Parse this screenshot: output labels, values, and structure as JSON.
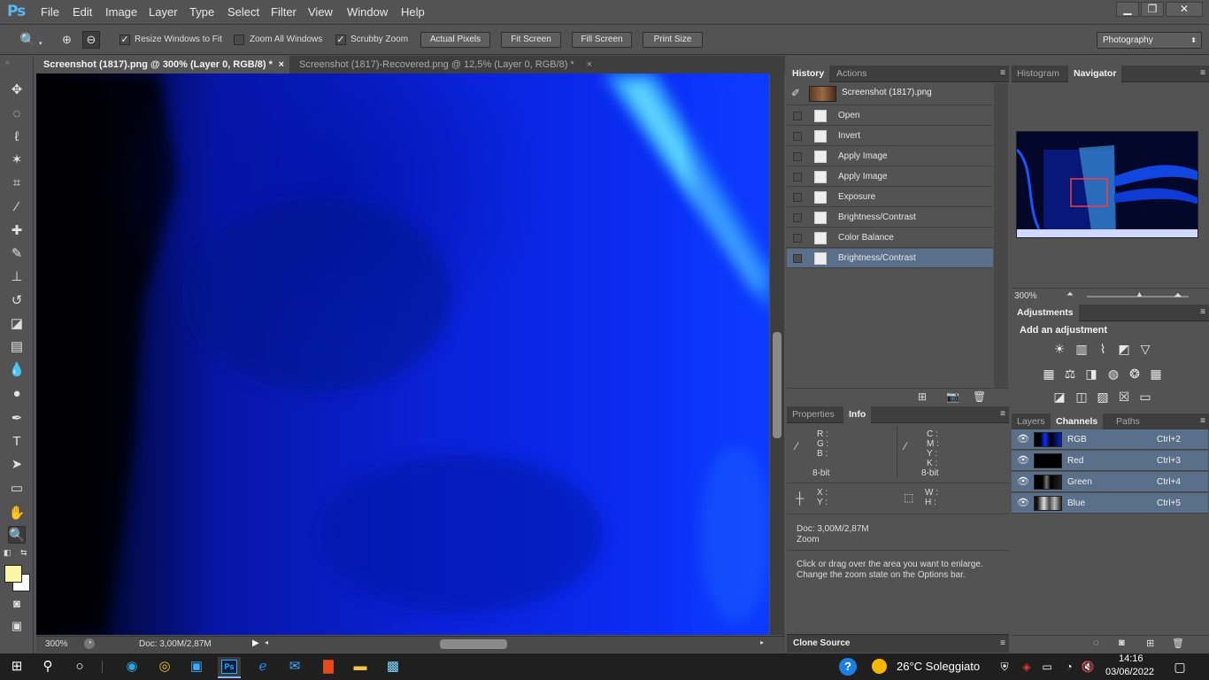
{
  "app": {
    "logo": "Ps"
  },
  "menu": [
    "File",
    "Edit",
    "Image",
    "Layer",
    "Type",
    "Select",
    "Filter",
    "View",
    "Window",
    "Help"
  ],
  "window_controls": {
    "minimize": "▁",
    "restore": "❐",
    "close": "✕"
  },
  "options": {
    "resize_windows_label": "Resize Windows to Fit",
    "resize_windows_checked": true,
    "zoom_all_label": "Zoom All Windows",
    "zoom_all_checked": false,
    "scrubby_label": "Scrubby Zoom",
    "scrubby_checked": true,
    "actual_pixels": "Actual Pixels",
    "fit_screen": "Fit Screen",
    "fill_screen": "Fill Screen",
    "print_size": "Print Size",
    "workspace": "Photography"
  },
  "doc_tabs": [
    {
      "label": "Screenshot (1817).png @ 300% (Layer 0, RGB/8) *",
      "close": "×"
    },
    {
      "label": "Screenshot (1817)-Recovered.png @ 12,5% (Layer 0, RGB/8) *",
      "close": "×"
    }
  ],
  "status": {
    "zoom": "300%",
    "doc": "Doc: 3,00M/2,87M"
  },
  "history_panel": {
    "tabs": [
      "History",
      "Actions"
    ],
    "snapshot": "Screenshot (1817).png",
    "states": [
      "Open",
      "Invert",
      "Apply Image",
      "Apply Image",
      "Exposure",
      "Brightness/Contrast",
      "Color Balance",
      "Brightness/Contrast"
    ]
  },
  "navigator_panel": {
    "tabs": [
      "Histogram",
      "Navigator"
    ],
    "zoom": "300%"
  },
  "adjustments_panel": {
    "title": "Adjustments",
    "subtitle": "Add an adjustment"
  },
  "info_panel": {
    "tabs": [
      "Properties",
      "Info"
    ],
    "rgb_labels": [
      "R :",
      "G :",
      "B :"
    ],
    "cmyk_labels": [
      "C :",
      "M :",
      "Y :",
      "K :"
    ],
    "bit_left": "8-bit",
    "bit_right": "8-bit",
    "xy_labels": [
      "X :",
      "Y :"
    ],
    "wh_labels": [
      "W :",
      "H :"
    ],
    "doc": "Doc: 3,00M/2,87M",
    "tool": "Zoom",
    "hint1": "Click or drag over the area you want to enlarge.",
    "hint2": "Change the zoom state on the Options bar."
  },
  "clone_source": {
    "title": "Clone Source"
  },
  "layers_panel": {
    "tabs": [
      "Layers",
      "Channels",
      "Paths"
    ],
    "channels": [
      {
        "name": "RGB",
        "shortcut": "Ctrl+2"
      },
      {
        "name": "Red",
        "shortcut": "Ctrl+3"
      },
      {
        "name": "Green",
        "shortcut": "Ctrl+4"
      },
      {
        "name": "Blue",
        "shortcut": "Ctrl+5"
      }
    ]
  },
  "taskbar": {
    "weather": "26°C  Soleggiato",
    "time": "14:16",
    "date": "03/06/2022",
    "ps_label": "Ps"
  },
  "colors": {
    "accent": "#5a6f89",
    "canvas_blue": "#0a1fd0",
    "foreground_swatch": "#fbf3a6",
    "background_swatch": "#ffffff"
  }
}
